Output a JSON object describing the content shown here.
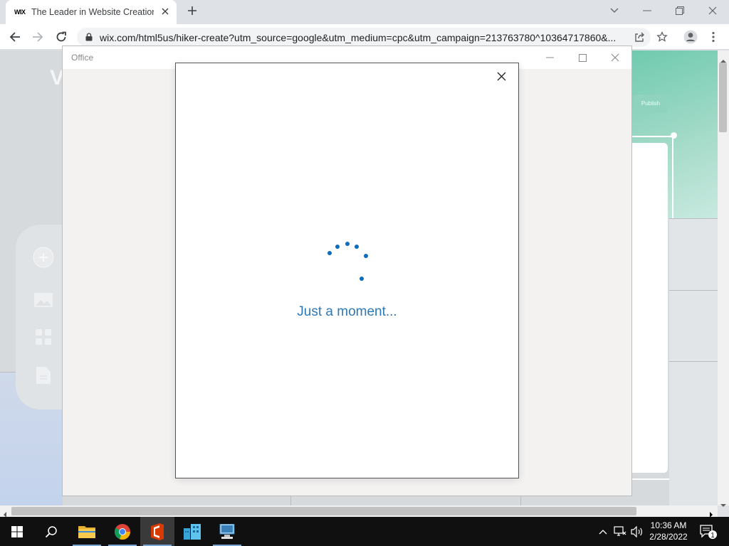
{
  "browser": {
    "tab": {
      "favicon_text": "WIX",
      "title": "The Leader in Website Creation |"
    },
    "address": "wix.com/html5us/hiker-create?utm_source=google&utm_medium=cpc&utm_campaign=213763780^10364717860&..."
  },
  "wix": {
    "heading_letter": "V",
    "publish_label": "Publish"
  },
  "office": {
    "title": "Office",
    "loading_text": "Just a moment..."
  },
  "taskbar": {
    "time": "10:36 AM",
    "date": "2/28/2022",
    "notification_count": "1"
  },
  "colors": {
    "accent_blue": "#2b79b8",
    "spinner_dot": "#0f6cbd",
    "taskbar_bg": "#101010",
    "wix_teal": "#6fcaae"
  }
}
